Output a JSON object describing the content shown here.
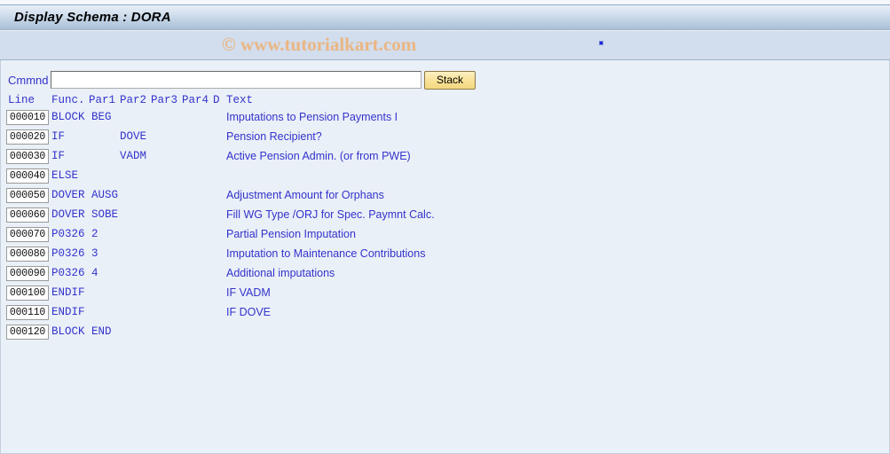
{
  "window": {
    "title": "Display Schema : DORA"
  },
  "watermark": {
    "text": "© www.tutorialkart.com"
  },
  "command_bar": {
    "label": "Cmmnd",
    "value": "",
    "placeholder": "",
    "stack_button_label": "Stack"
  },
  "table": {
    "headers": {
      "line": "Line",
      "func": "Func.",
      "par1": "Par1",
      "par2": "Par2",
      "par3": "Par3",
      "par4": "Par4",
      "d": "D",
      "text": "Text"
    },
    "rows": [
      {
        "line": "000010",
        "func": "BLOCK BEG",
        "par1": "",
        "par2": "",
        "par3": "",
        "par4": "",
        "d": "",
        "text": "Imputations to Pension Payments I"
      },
      {
        "line": "000020",
        "func": "IF",
        "par1": "",
        "par2": "DOVE",
        "par3": "",
        "par4": "",
        "d": "",
        "text": "Pension Recipient?"
      },
      {
        "line": "000030",
        "func": "IF",
        "par1": "",
        "par2": "VADM",
        "par3": "",
        "par4": "",
        "d": "",
        "text": "Active Pension Admin. (or from PWE)"
      },
      {
        "line": "000040",
        "func": "ELSE",
        "par1": "",
        "par2": "",
        "par3": "",
        "par4": "",
        "d": "",
        "text": ""
      },
      {
        "line": "000050",
        "func": "DOVER AUSG",
        "par1": "",
        "par2": "",
        "par3": "",
        "par4": "",
        "d": "",
        "text": "Adjustment Amount for Orphans"
      },
      {
        "line": "000060",
        "func": "DOVER SOBE",
        "par1": "",
        "par2": "",
        "par3": "",
        "par4": "",
        "d": "",
        "text": "Fill WG Type /ORJ for Spec. Paymnt Calc."
      },
      {
        "line": "000070",
        "func": "P0326 2",
        "par1": "",
        "par2": "",
        "par3": "",
        "par4": "",
        "d": "",
        "text": "Partial Pension Imputation"
      },
      {
        "line": "000080",
        "func": "P0326 3",
        "par1": "",
        "par2": "",
        "par3": "",
        "par4": "",
        "d": "",
        "text": "Imputation to Maintenance Contributions"
      },
      {
        "line": "000090",
        "func": "P0326 4",
        "par1": "",
        "par2": "",
        "par3": "",
        "par4": "",
        "d": "",
        "text": "Additional imputations"
      },
      {
        "line": "000100",
        "func": "ENDIF",
        "par1": "",
        "par2": "",
        "par3": "",
        "par4": "",
        "d": "",
        "text": "IF VADM"
      },
      {
        "line": "000110",
        "func": "ENDIF",
        "par1": "",
        "par2": "",
        "par3": "",
        "par4": "",
        "d": "",
        "text": "IF DOVE"
      },
      {
        "line": "000120",
        "func": "BLOCK END",
        "par1": "",
        "par2": "",
        "par3": "",
        "par4": "",
        "d": "",
        "text": ""
      }
    ]
  },
  "colors": {
    "accent_blue": "#3333cc",
    "title_bar_bottom": "#a9bfd7",
    "content_bg": "#eaf0f7",
    "band_bg": "#d2dded",
    "button_gold": "#f3d77e",
    "watermark": "#eab683"
  }
}
